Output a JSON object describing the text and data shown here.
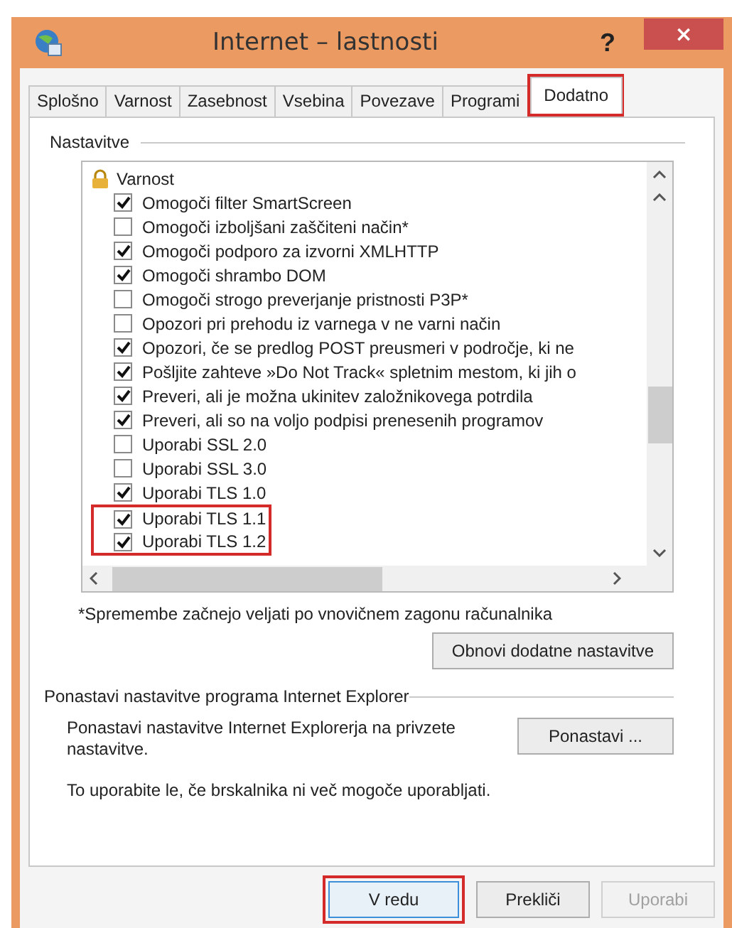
{
  "window": {
    "title": "Internet – lastnosti",
    "help_button": "?",
    "close_button": "×"
  },
  "tabs": [
    {
      "label": "Splošno",
      "selected": false,
      "highlighted": false
    },
    {
      "label": "Varnost",
      "selected": false,
      "highlighted": false
    },
    {
      "label": "Zasebnost",
      "selected": false,
      "highlighted": false
    },
    {
      "label": "Vsebina",
      "selected": false,
      "highlighted": false
    },
    {
      "label": "Povezave",
      "selected": false,
      "highlighted": false
    },
    {
      "label": "Programi",
      "selected": false,
      "highlighted": false
    },
    {
      "label": "Dodatno",
      "selected": true,
      "highlighted": true
    }
  ],
  "settings": {
    "label": "Nastavitve",
    "groups": [
      {
        "label": "Varnost",
        "children": [
          {
            "label": "Omogoči filter SmartScreen",
            "checked": true,
            "highlighted": false
          },
          {
            "label": "Omogoči izboljšani zaščiteni način*",
            "checked": false,
            "highlighted": false
          },
          {
            "label": "Omogoči podporo za izvorni XMLHTTP",
            "checked": true,
            "highlighted": false
          },
          {
            "label": "Omogoči shrambo DOM",
            "checked": true,
            "highlighted": false
          },
          {
            "label": "Omogoči strogo preverjanje pristnosti P3P*",
            "checked": false,
            "highlighted": false
          },
          {
            "label": "Opozori pri prehodu iz varnega v ne varni način",
            "checked": false,
            "highlighted": false
          },
          {
            "label": "Opozori, če se predlog POST preusmeri v področje, ki ne",
            "checked": true,
            "highlighted": false
          },
          {
            "label": "Pošljite zahteve »Do Not Track« spletnim mestom, ki jih o",
            "checked": true,
            "highlighted": false
          },
          {
            "label": "Preveri, ali je možna ukinitev založnikovega potrdila",
            "checked": true,
            "highlighted": false
          },
          {
            "label": "Preveri, ali so na voljo podpisi prenesenih programov",
            "checked": true,
            "highlighted": false
          },
          {
            "label": "Uporabi SSL 2.0",
            "checked": false,
            "highlighted": false
          },
          {
            "label": "Uporabi SSL 3.0",
            "checked": false,
            "highlighted": false
          },
          {
            "label": "Uporabi TLS 1.0",
            "checked": true,
            "highlighted": false
          },
          {
            "label": "Uporabi TLS 1.1",
            "checked": true,
            "highlighted": true
          },
          {
            "label": "Uporabi TLS 1.2",
            "checked": true,
            "highlighted": true
          }
        ]
      }
    ],
    "note": "*Spremembe začnejo veljati po vnovičnem zagonu računalnika",
    "restore_button": "Obnovi dodatne nastavitve"
  },
  "reset": {
    "label": "Ponastavi nastavitve programa Internet Explorer",
    "description": "Ponastavi nastavitve Internet Explorerja na privzete nastavitve.",
    "button": "Ponastavi ...",
    "hint": "To uporabite le, če brskalnika ni več mogoče uporabljati."
  },
  "buttons": [
    {
      "label": "V redu",
      "default": true,
      "disabled": false,
      "highlighted": true
    },
    {
      "label": "Prekliči",
      "default": false,
      "disabled": false,
      "highlighted": false
    },
    {
      "label": "Uporabi",
      "default": false,
      "disabled": true,
      "highlighted": false
    }
  ]
}
